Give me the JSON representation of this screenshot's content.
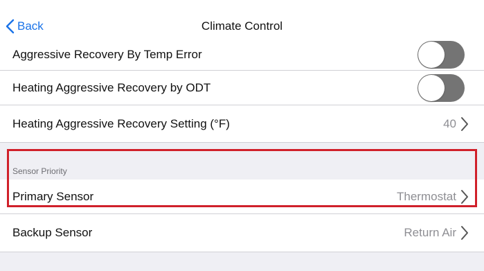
{
  "header": {
    "back_label": "Back",
    "title": "Climate Control",
    "back_icon": "chevron-left-icon"
  },
  "settings": {
    "aggressive_recovery_by_temp_error": {
      "label": "Aggressive Recovery By Temp Error",
      "enabled": false
    },
    "heating_aggressive_recovery_by_odt": {
      "label": "Heating Aggressive Recovery by ODT",
      "enabled": false
    },
    "heating_aggressive_recovery_setting": {
      "label": "Heating Aggressive Recovery Setting (°F)",
      "value": "40"
    }
  },
  "sensor_priority": {
    "section_label": "Sensor Priority",
    "primary": {
      "label": "Primary Sensor",
      "value": "Thermostat"
    },
    "backup": {
      "label": "Backup Sensor",
      "value": "Return Air"
    }
  },
  "colors": {
    "accent": "#1a73e8",
    "toggle_off": "#747474",
    "highlight_border": "#d0202a",
    "background": "#efeff4",
    "secondary_text": "#8e8e93"
  }
}
